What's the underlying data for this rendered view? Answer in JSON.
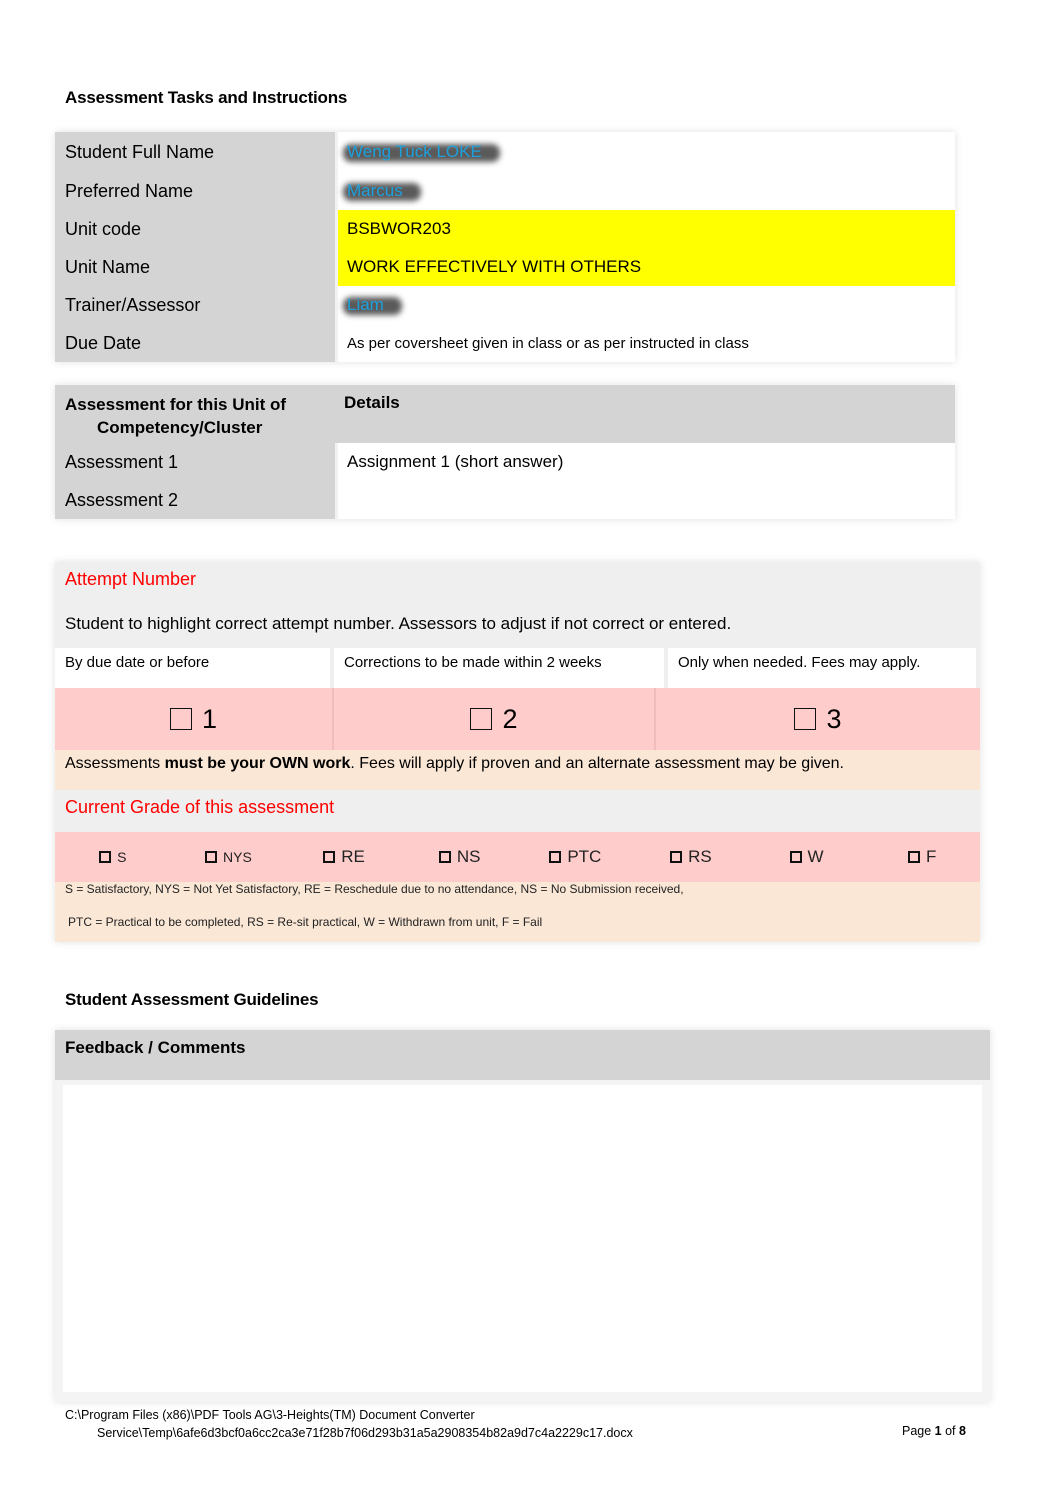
{
  "headings": {
    "tasks": "Assessment Tasks and Instructions",
    "guidelines": "Student Assessment Guidelines"
  },
  "student_info": [
    {
      "label": "Student Full Name",
      "value": "Weng Tuck LOKE",
      "redacted": true
    },
    {
      "label": "Preferred Name",
      "value": "Marcus",
      "redacted": true
    },
    {
      "label": "Unit code",
      "value": "BSBWOR203",
      "highlight": "#ffff00"
    },
    {
      "label": "Unit Name",
      "value": "WORK EFFECTIVELY WITH OTHERS",
      "highlight": "#ffff00"
    },
    {
      "label": "Trainer/Assessor",
      "value": "Liam",
      "redacted": true
    },
    {
      "label": "Due Date",
      "value": "As per coversheet given in class or as per instructed in class"
    }
  ],
  "assessment_table": {
    "header_left_line1": "Assessment for this Unit of",
    "header_left_line2": "Competency/Cluster",
    "header_right": "Details",
    "rows": [
      {
        "label": "Assessment 1",
        "detail": "Assignment 1 (short answer)"
      },
      {
        "label": "Assessment 2",
        "detail": ""
      }
    ]
  },
  "attempt": {
    "title": "Attempt Number",
    "instruction": "Student to highlight correct attempt number. Assessors to adjust if not correct or entered.",
    "columns": [
      {
        "caption": "By due date or before",
        "number": "1",
        "checked": false
      },
      {
        "caption": "Corrections to be made within 2 weeks",
        "number": "2",
        "checked": false
      },
      {
        "caption": "Only when needed. Fees may apply.",
        "number": "3",
        "checked": false
      }
    ],
    "own_work_prefix": "Assessments ",
    "own_work_bold": "must be your OWN work",
    "own_work_suffix": ". Fees will apply if proven and an alternate assessment may be given."
  },
  "grade": {
    "title": "Current Grade of this assessment",
    "options": [
      {
        "code": "S",
        "checked": false
      },
      {
        "code": "NYS",
        "checked": false
      },
      {
        "code": "RE",
        "checked": false
      },
      {
        "code": "NS",
        "checked": false
      },
      {
        "code": "PTC",
        "checked": false
      },
      {
        "code": "RS",
        "checked": false
      },
      {
        "code": "W",
        "checked": false
      },
      {
        "code": "F",
        "checked": false
      }
    ],
    "legend_line1": "S = Satisfactory, NYS = Not Yet Satisfactory, RE = Reschedule due to no attendance, NS = No Submission received,",
    "legend_line2": "PTC = Practical to be completed, RS = Re-sit practical, W = Withdrawn from unit, F = Fail"
  },
  "feedback": {
    "title": "Feedback / Comments",
    "value": ""
  },
  "footer": {
    "path_line1": "C:\\Program Files (x86)\\PDF Tools AG\\3-Heights(TM) Document Converter",
    "path_line2": "Service\\Temp\\6afe6d3bcf0a6cc2ca3e71f28b7f06d293b31a5a2908354b82a9d7c4a2229c17.docx",
    "page_word": "Page ",
    "page_current": "1",
    "page_of": " of ",
    "page_total": "8"
  },
  "colors": {
    "label_bg": "#d4d4d4",
    "highlight": "#ffff00",
    "section_red": "#ff0000",
    "redacted_text": "#1ea0dc",
    "attempt_pink": "#ffcccc",
    "notice_peach": "#fae7d6"
  }
}
